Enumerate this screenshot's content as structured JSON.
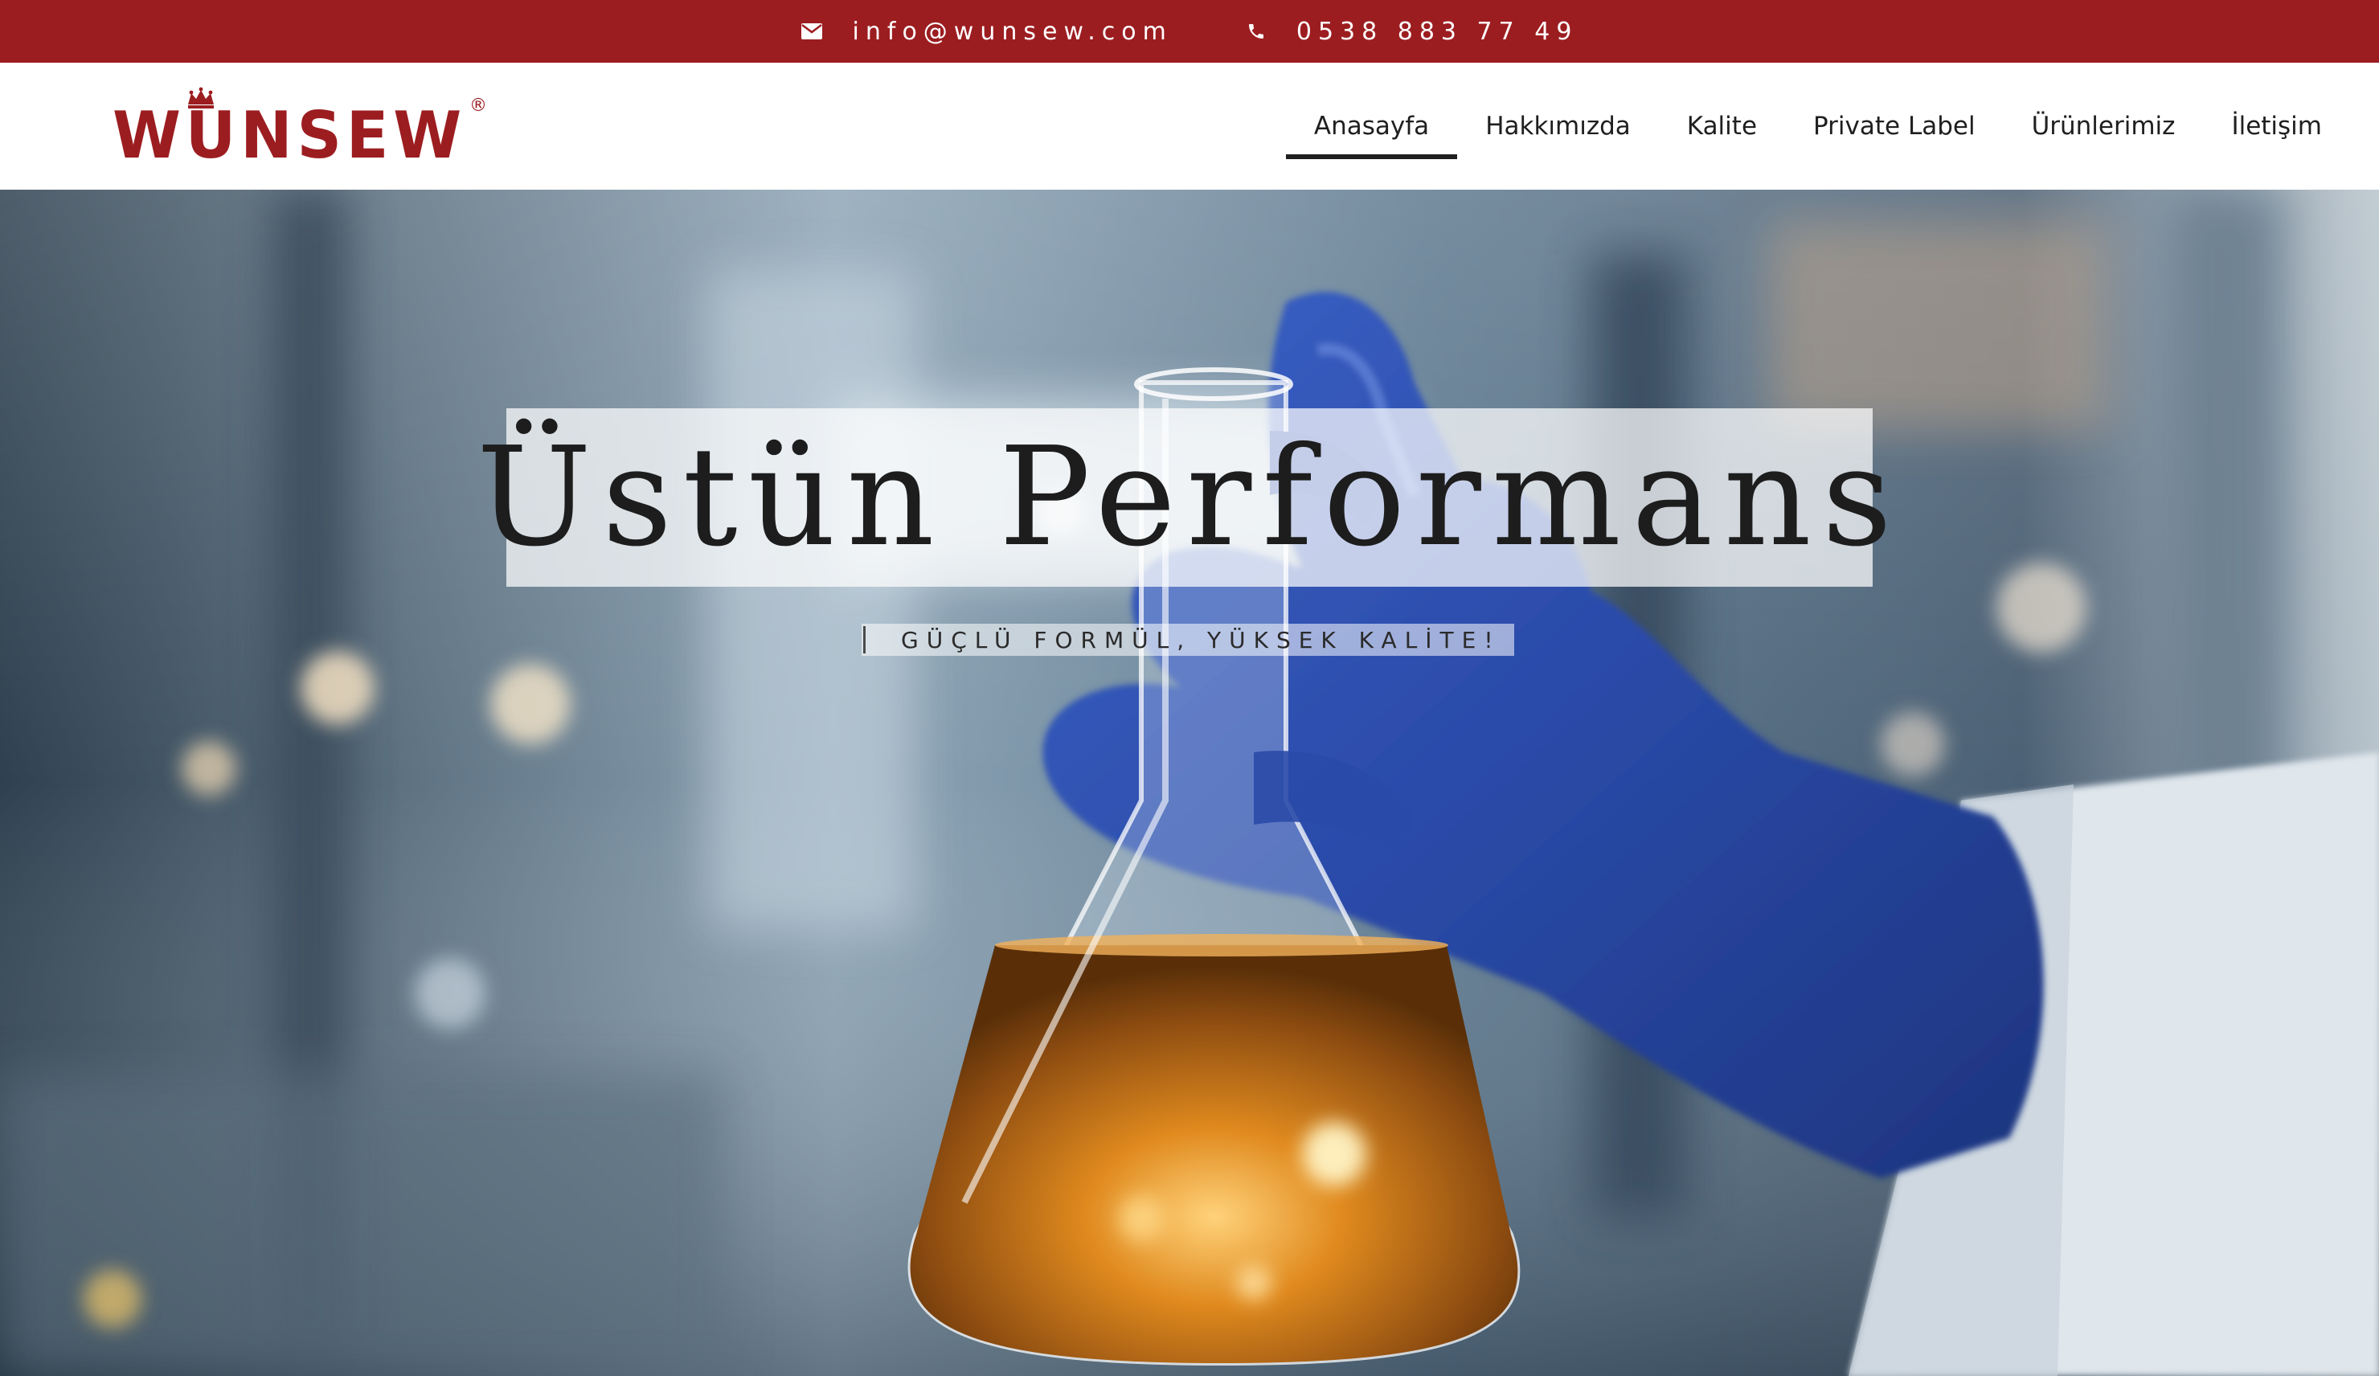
{
  "topbar": {
    "email": "info@wunsew.com",
    "phone": "0538 883 77 49",
    "background": "#9c1d20",
    "email_icon": "envelope-icon",
    "phone_icon": "phone-icon"
  },
  "brand": {
    "name": "WUNSEW",
    "registered": "®",
    "color": "#9c1d20",
    "crown_icon": "crown-icon"
  },
  "nav": {
    "items": [
      {
        "label": "Anasayfa",
        "active": true
      },
      {
        "label": "Hakkımızda",
        "active": false
      },
      {
        "label": "Kalite",
        "active": false
      },
      {
        "label": "Private Label",
        "active": false
      },
      {
        "label": "Ürünlerimiz",
        "active": false
      },
      {
        "label": "İletişim",
        "active": false
      }
    ]
  },
  "hero": {
    "headline": "Üstün Performans",
    "tagline": "GÜÇLÜ FORMÜL, YÜKSEK KALİTE!",
    "image": "lab-flask-gloved-hand"
  }
}
